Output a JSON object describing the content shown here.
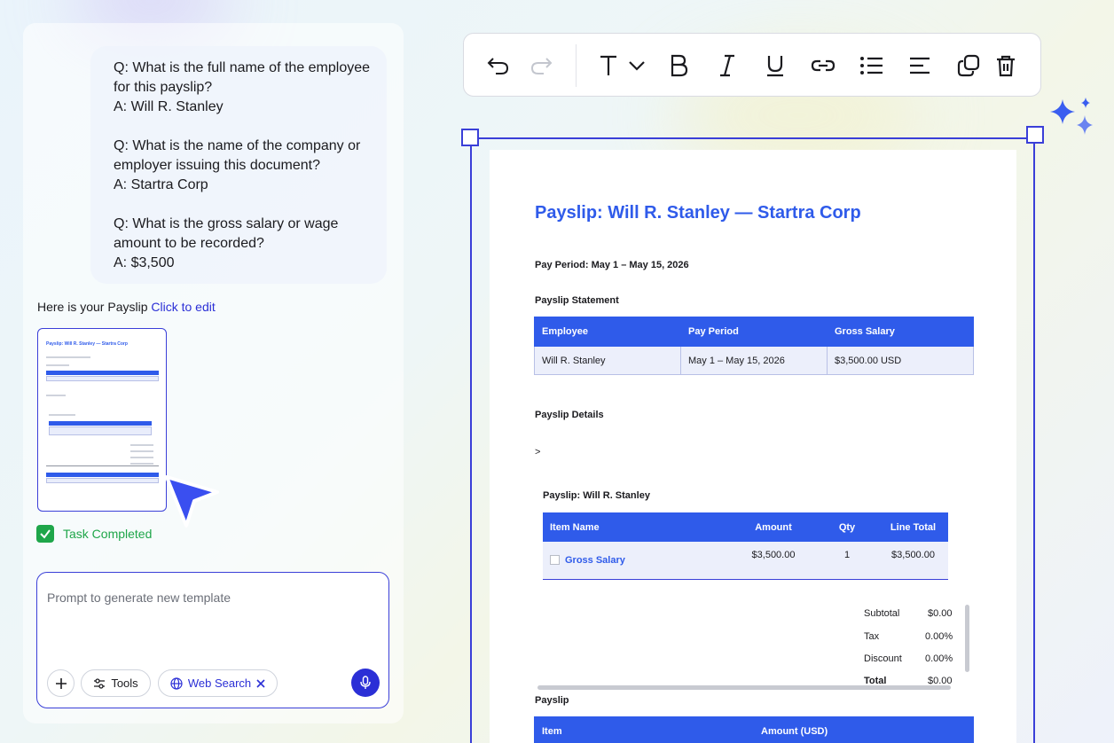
{
  "chat": {
    "qa": [
      {
        "q": "Q: What is the full name of the employee for this payslip?",
        "a": "A: Will R. Stanley"
      },
      {
        "q": "Q: What is the name of the company or employer issuing this document?",
        "a": "A: Startra Corp"
      },
      {
        "q": "Q: What is the gross salary or wage amount to be recorded?",
        "a": "A: $3,500"
      }
    ],
    "intro_text": "Here is your Payslip",
    "intro_link": "Click to edit",
    "thumb_title": "Payslip: Will R. Stanley — Startra Corp",
    "task_status": "Task Completed"
  },
  "prompt": {
    "placeholder": "Prompt to generate new template",
    "tools_label": "Tools",
    "web_search_label": "Web Search"
  },
  "toolbar": {
    "icons": [
      "undo-icon",
      "redo-icon",
      "text-type-icon",
      "chevron-down-icon",
      "bold-icon",
      "italic-icon",
      "underline-icon",
      "link-icon",
      "bullet-list-icon",
      "align-icon",
      "duplicate-icon",
      "trash-icon"
    ]
  },
  "document": {
    "title": "Payslip: Will R. Stanley — Startra Corp",
    "pay_period": "Pay Period: May 1 – May 15, 2026",
    "statement_heading": "Payslip Statement",
    "statement_table": {
      "headers": [
        "Employee",
        "Pay Period",
        "Gross Salary"
      ],
      "row": [
        "Will R. Stanley",
        "May 1 – May 15, 2026",
        "$3,500.00 USD"
      ]
    },
    "details_heading": "Payslip Details",
    "details_marker": ">",
    "items_heading": "Payslip: Will R. Stanley",
    "items_table": {
      "headers": [
        "Item Name",
        "Amount",
        "Qty",
        "Line Total"
      ],
      "row": {
        "name": "Gross Salary",
        "amount": "$3,500.00",
        "qty": "1",
        "total": "$3,500.00"
      }
    },
    "summary": [
      {
        "label": "Subtotal",
        "value": "$0.00"
      },
      {
        "label": "Tax",
        "value": "0.00%"
      },
      {
        "label": "Discount",
        "value": "0.00%"
      },
      {
        "label": "Total",
        "value": "$0.00"
      }
    ],
    "payslip_heading": "Payslip",
    "payslip_table_headers": [
      "Item",
      "Amount (USD)"
    ]
  },
  "colors": {
    "accent": "#2f5bea",
    "frame": "#3a3fd8",
    "success": "#1fa64a"
  }
}
